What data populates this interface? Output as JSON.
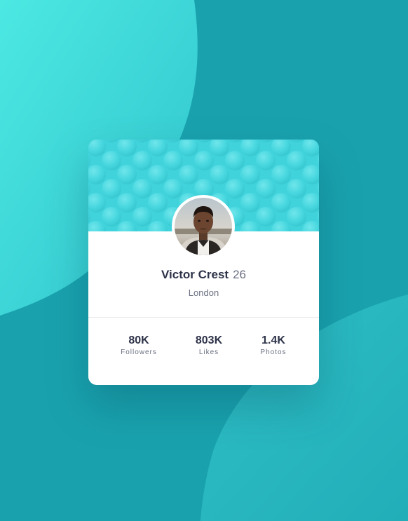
{
  "profile": {
    "name": "Victor Crest",
    "age": "26",
    "location": "London"
  },
  "stats": [
    {
      "value": "80K",
      "label": "Followers"
    },
    {
      "value": "803K",
      "label": "Likes"
    },
    {
      "value": "1.4K",
      "label": "Photos"
    }
  ],
  "colors": {
    "background": "#19a2ae",
    "banner": "#40d3dc",
    "card": "#ffffff",
    "text_dark": "#2e3349",
    "text_muted": "#6b7082"
  },
  "icons": {
    "background_pattern": "wave-circles-background",
    "banner_pattern": "bubble-pattern",
    "avatar": "profile-photo"
  }
}
